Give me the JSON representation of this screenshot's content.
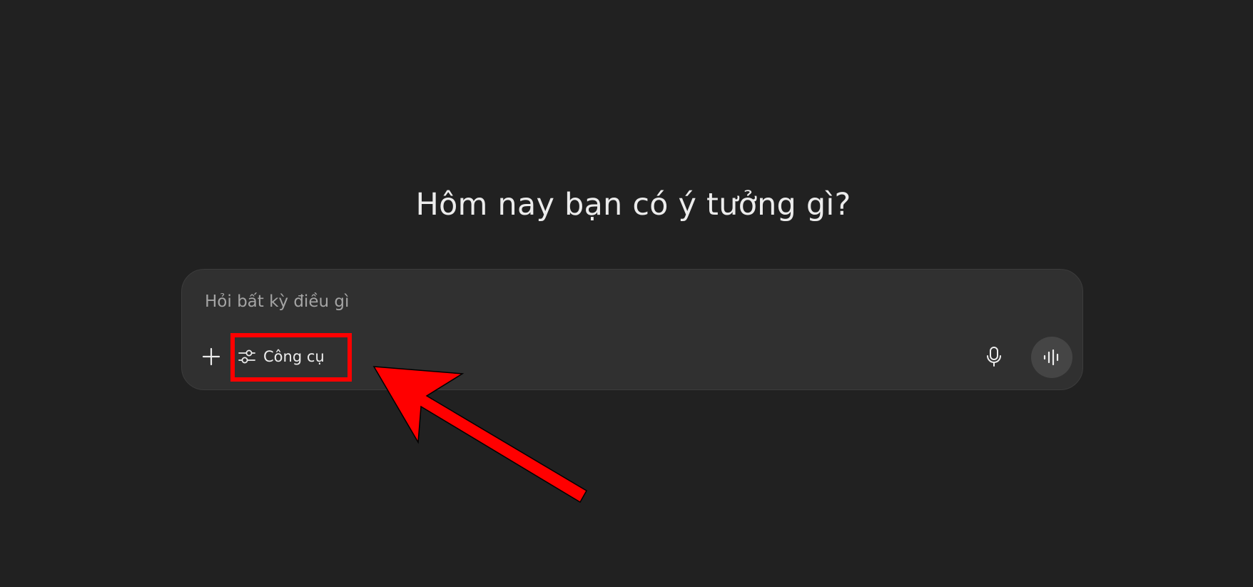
{
  "heading": "Hôm nay bạn có ý tưởng gì?",
  "composer": {
    "placeholder": "Hỏi bất kỳ điều gì",
    "value": "",
    "plus_icon": "plus-icon",
    "tools_label": "Công cụ",
    "tools_icon": "sliders-icon",
    "mic_icon": "microphone-icon",
    "voice_icon": "voice-waveform-icon"
  },
  "annotation": {
    "highlight_color": "#ff0000",
    "arrow_color": "#ff0000"
  },
  "colors": {
    "background": "#212121",
    "composer": "#303030",
    "text": "#ececec",
    "placeholder": "#a4a4a4",
    "voice_button": "#454545"
  }
}
